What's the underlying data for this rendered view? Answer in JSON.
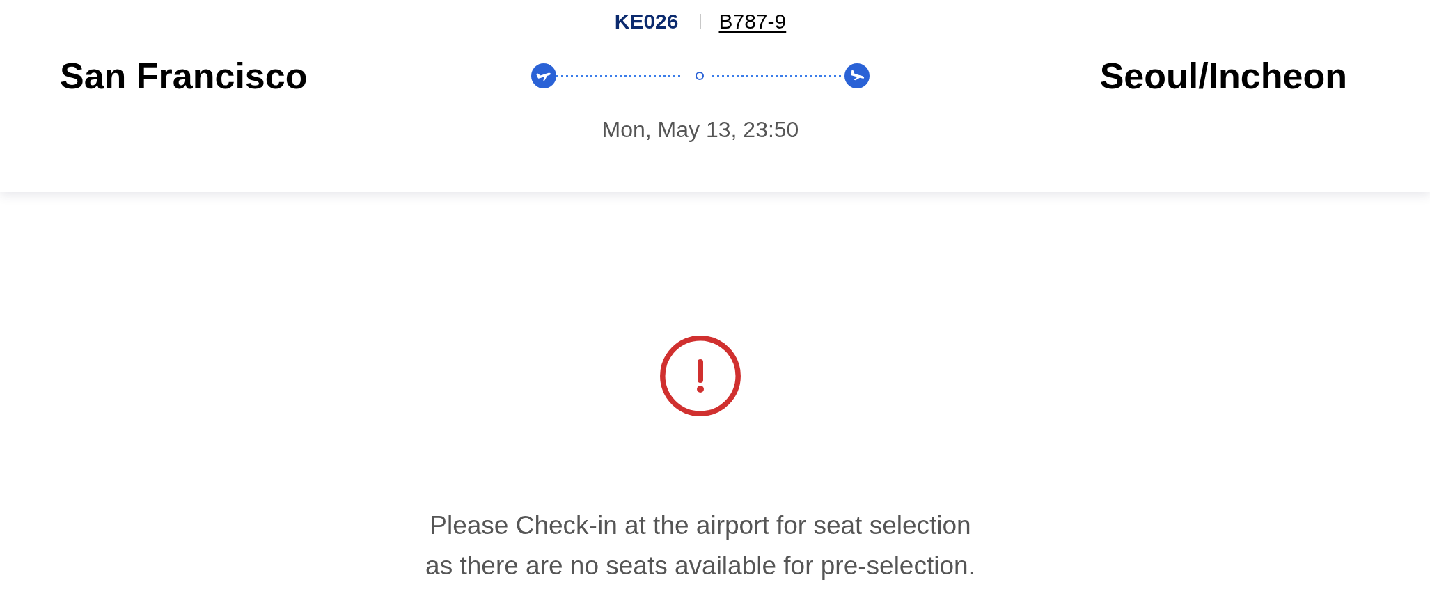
{
  "flight": {
    "number": "KE026",
    "aircraft": "B787-9"
  },
  "route": {
    "origin": "San Francisco",
    "destination": "Seoul/Incheon",
    "departure_time": "Mon, May 13, 23:50"
  },
  "notice": {
    "kind": "error",
    "message": "Please Check-in at the airport for seat selection\nas there are no seats available for pre-selection."
  }
}
